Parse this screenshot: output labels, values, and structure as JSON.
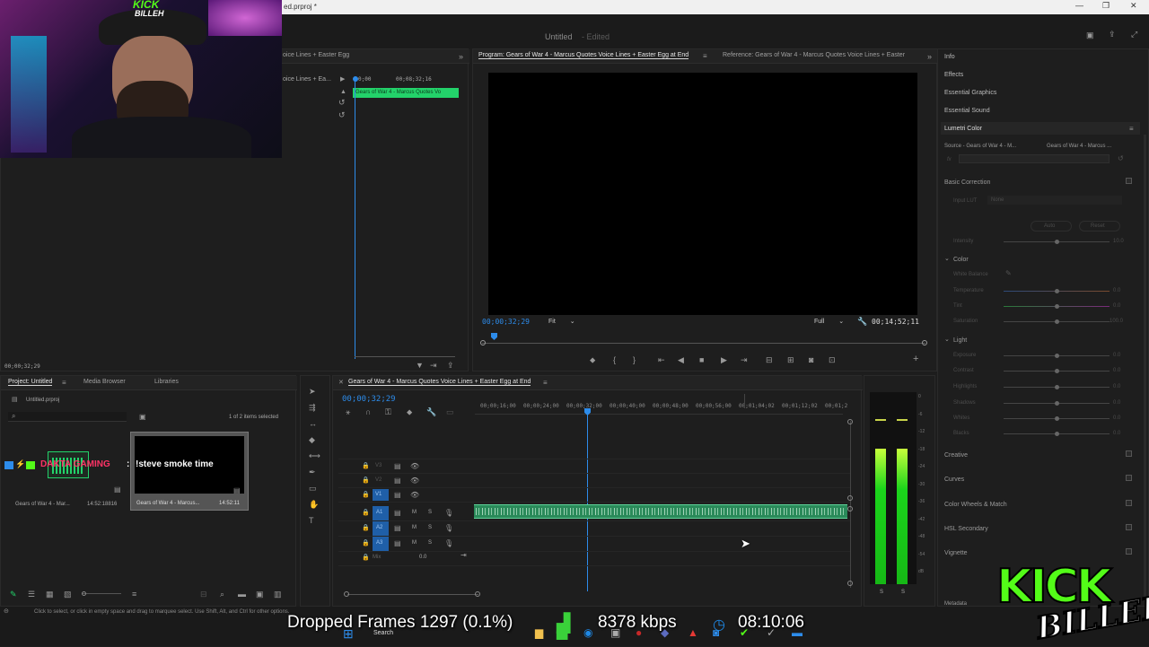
{
  "window": {
    "title": "ed.prproj *",
    "controls": [
      "—",
      "❐",
      "✕"
    ]
  },
  "app": {
    "doc_title": "Untitled",
    "doc_status": "- Edited"
  },
  "source_panel": {
    "tab": "oice Lines + Easter Egg",
    "sub_label": "oice Lines + Ea...",
    "timecode_a": "0;00",
    "timecode_b": "00;08;32;16",
    "clip_label": "Gears of War 4 - Marcus Quotes Vo",
    "timecode_bottom": "00;00;32;29"
  },
  "program_monitor": {
    "tab_program": "Program: Gears of War 4 - Marcus Quotes Voice Lines + Easter Egg at End",
    "tab_reference": "Reference: Gears of War 4 - Marcus Quotes Voice Lines + Easter",
    "timecode": "00;00;32;29",
    "fit": "Fit",
    "quality": "Full",
    "duration": "00;14;52;11"
  },
  "right_panel": {
    "items": [
      "Info",
      "Effects",
      "Essential Graphics",
      "Essential Sound",
      "Lumetri Color"
    ],
    "source_label": "Source - Gears of War 4 - M...",
    "target_label": "Gears of War 4 - Marcus ...",
    "fx_label": "fx",
    "basic_correction": "Basic Correction",
    "input_lut": "Input LUT",
    "input_lut_value": "None",
    "auto": "Auto",
    "reset": "Reset",
    "intensity": "Intensity",
    "intensity_value": "10.0",
    "color_section": "Color",
    "white_balance": "White Balance",
    "color_sliders": [
      {
        "label": "Temperature",
        "value": "0.0"
      },
      {
        "label": "Tint",
        "value": "0.0"
      },
      {
        "label": "Saturation",
        "value": "100.0"
      }
    ],
    "light_section": "Light",
    "light_sliders": [
      {
        "label": "Exposure",
        "value": "0.0"
      },
      {
        "label": "Contrast",
        "value": "0.0"
      },
      {
        "label": "Highlights",
        "value": "0.0"
      },
      {
        "label": "Shadows",
        "value": "0.0"
      },
      {
        "label": "Whites",
        "value": "0.0"
      },
      {
        "label": "Blacks",
        "value": "0.0"
      }
    ],
    "sections": [
      "Creative",
      "Curves",
      "Color Wheels & Match",
      "HSL Secondary",
      "Vignette"
    ],
    "metadata": "Metadata"
  },
  "project_panel": {
    "tabs": [
      "Project: Untitled",
      "Media Browser",
      "Libraries"
    ],
    "file": "Untitled.prproj",
    "items_selected": "1 of 2 items selected",
    "items": [
      {
        "name": "Gears of War 4 - Mar...",
        "duration": "14:52:18816"
      },
      {
        "name": "Gears of War 4 - Marcus...",
        "duration": "14:52:11"
      }
    ],
    "overlay_text": "!steve smoke time",
    "channel_tag": "DAKTA GAMING"
  },
  "timeline": {
    "tab": "Gears of War 4 - Marcus Quotes Voice Lines + Easter Egg at End",
    "timecode": "00;00;32;29",
    "ruler": [
      "00;00;16;00",
      "00;00;24;00",
      "00;00;32;00",
      "00;00;40;00",
      "00;00;48;00",
      "00;00;56;00",
      "00;01;04;02",
      "00;01;12;02",
      "00;01;2"
    ],
    "video_tracks": [
      "V3",
      "V2",
      "V1"
    ],
    "audio_tracks": [
      "A1",
      "A2",
      "A3"
    ],
    "track_letters": {
      "mute": "M",
      "solo": "S"
    },
    "mix_label": "Mix",
    "mix_value": "0.0"
  },
  "meter": {
    "labels": [
      "0",
      "-6",
      "-12",
      "-18",
      "-24",
      "-30",
      "-36",
      "-42",
      "-48",
      "-54",
      "dB"
    ],
    "bottom": [
      "S",
      "S"
    ],
    "levels": [
      0.82,
      0.82
    ]
  },
  "status_bar": {
    "hint": "Click to select, or click in empty space and drag to marquee select. Use Shift, Alt, and Ctrl for other options."
  },
  "stream_overlay": {
    "dropped": "Dropped Frames 1297 (0.1%)",
    "bitrate": "8378 kbps",
    "clock": "08:10:06"
  },
  "taskbar": {
    "search": "Search"
  },
  "logo": {
    "top": "KICK",
    "bottom": "BILLEH",
    "small_logo_top": "KICK",
    "small_logo_bottom": "BILLEH"
  },
  "colors": {
    "accent": "#2d8ceb",
    "clip_green": "#23d26a",
    "audio_green": "#2a8a5a",
    "kick_green": "#53fc18"
  }
}
